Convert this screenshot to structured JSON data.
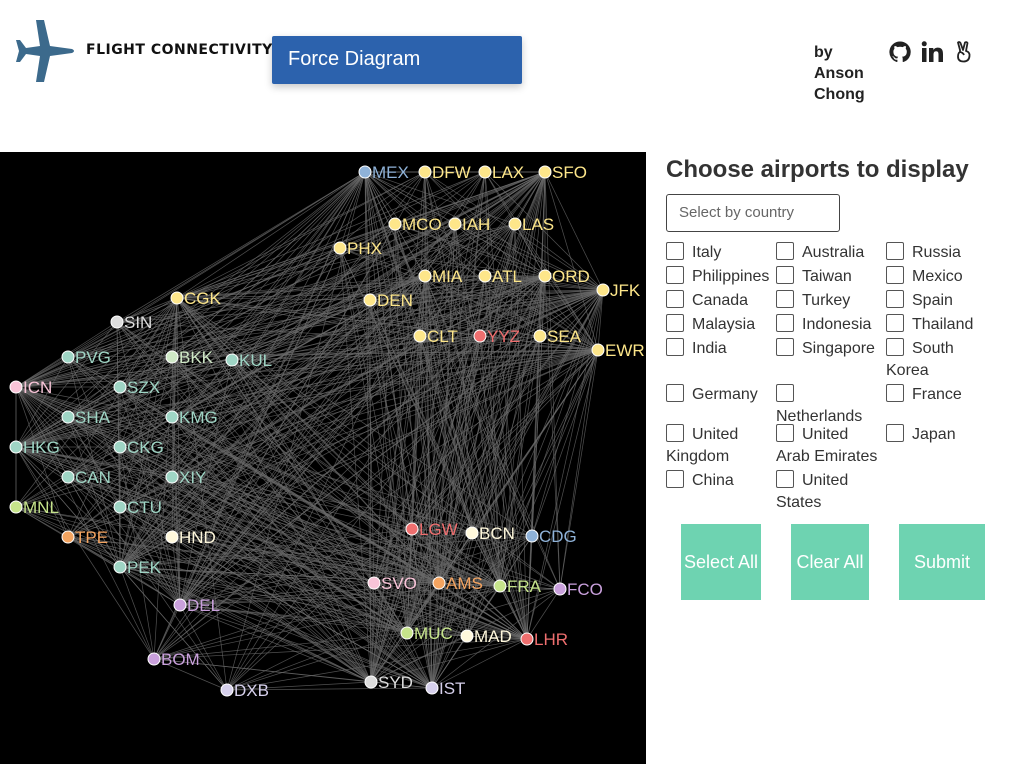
{
  "header": {
    "brand": "FLIGHT CONNECTIVITY",
    "view_button": "Force Diagram",
    "author": [
      "by",
      "Anson",
      "Chong"
    ],
    "social_icons": [
      "github-icon",
      "linkedin-icon",
      "angellist-icon"
    ]
  },
  "colors": {
    "button_blue": "#2c62ad",
    "action_green": "#6ed3b1",
    "graph_background": "#000000",
    "edge": "#6b6b6b",
    "americas": "#fde68a",
    "americas_alt": "#8fb2d8",
    "east_asia": "#9fd5c5",
    "europe_red": "#ef6f6f",
    "pink": "#f8c4d8",
    "purple": "#c9a0dc"
  },
  "graph": {
    "airports": [
      {
        "code": "MEX",
        "color": "#8fb2d8"
      },
      {
        "code": "DFW",
        "color": "#fde68a"
      },
      {
        "code": "LAX",
        "color": "#fde68a"
      },
      {
        "code": "SFO",
        "color": "#fde68a"
      },
      {
        "code": "MCO",
        "color": "#fde68a"
      },
      {
        "code": "IAH",
        "color": "#fde68a"
      },
      {
        "code": "LAS",
        "color": "#fde68a"
      },
      {
        "code": "PHX",
        "color": "#fde68a"
      },
      {
        "code": "MIA",
        "color": "#fde68a"
      },
      {
        "code": "ATL",
        "color": "#fde68a"
      },
      {
        "code": "ORD",
        "color": "#fde68a"
      },
      {
        "code": "JFK",
        "color": "#fde68a"
      },
      {
        "code": "DEN",
        "color": "#fde68a"
      },
      {
        "code": "CGK",
        "color": "#fde68a"
      },
      {
        "code": "SIN",
        "color": "#dddddd"
      },
      {
        "code": "CLT",
        "color": "#fde68a"
      },
      {
        "code": "YYZ",
        "color": "#ef6f6f"
      },
      {
        "code": "SEA",
        "color": "#fde68a"
      },
      {
        "code": "EWR",
        "color": "#fde68a"
      },
      {
        "code": "PVG",
        "color": "#9fd5c5"
      },
      {
        "code": "BKK",
        "color": "#cfe8c6"
      },
      {
        "code": "KUL",
        "color": "#9fd5c5"
      },
      {
        "code": "ICN",
        "color": "#f8c4d8"
      },
      {
        "code": "SZX",
        "color": "#9fd5c5"
      },
      {
        "code": "SHA",
        "color": "#9fd5c5"
      },
      {
        "code": "KMG",
        "color": "#9fd5c5"
      },
      {
        "code": "HKG",
        "color": "#9fd5c5"
      },
      {
        "code": "CKG",
        "color": "#9fd5c5"
      },
      {
        "code": "CAN",
        "color": "#9fd5c5"
      },
      {
        "code": "XIY",
        "color": "#9fd5c5"
      },
      {
        "code": "MNL",
        "color": "#c6e48b"
      },
      {
        "code": "CTU",
        "color": "#9fd5c5"
      },
      {
        "code": "TPE",
        "color": "#f4a460"
      },
      {
        "code": "HND",
        "color": "#fff8dc"
      },
      {
        "code": "PEK",
        "color": "#9fd5c5"
      },
      {
        "code": "LGW",
        "color": "#ef6f6f"
      },
      {
        "code": "BCN",
        "color": "#fff8dc"
      },
      {
        "code": "CDG",
        "color": "#8fb2d8"
      },
      {
        "code": "DEL",
        "color": "#c9a0dc"
      },
      {
        "code": "SVO",
        "color": "#f8c4d8"
      },
      {
        "code": "AMS",
        "color": "#f4a460"
      },
      {
        "code": "FRA",
        "color": "#c6e48b"
      },
      {
        "code": "FCO",
        "color": "#c9a0dc"
      },
      {
        "code": "MUC",
        "color": "#c6e48b"
      },
      {
        "code": "MAD",
        "color": "#fff8dc"
      },
      {
        "code": "LHR",
        "color": "#ef6f6f"
      },
      {
        "code": "BOM",
        "color": "#c9a0dc"
      },
      {
        "code": "DXB",
        "color": "#d6d0ec"
      },
      {
        "code": "SYD",
        "color": "#dddddd"
      },
      {
        "code": "IST",
        "color": "#d6d0ec"
      }
    ]
  },
  "panel": {
    "title": "Choose airports to display",
    "select_placeholder": "Select by country",
    "countries": [
      "Italy",
      "Australia",
      "Russia",
      "Philippines",
      "Taiwan",
      "Mexico",
      "Canada",
      "Turkey",
      "Spain",
      "Malaysia",
      "Indonesia",
      "Thailand",
      "India",
      "Singapore",
      "South Korea",
      "Germany",
      "Netherlands",
      "France",
      "United Kingdom",
      "United Arab Emirates",
      "Japan",
      "China",
      "United States"
    ],
    "buttons": {
      "select_all": "Select All",
      "clear_all": "Clear All",
      "submit": "Submit"
    }
  }
}
